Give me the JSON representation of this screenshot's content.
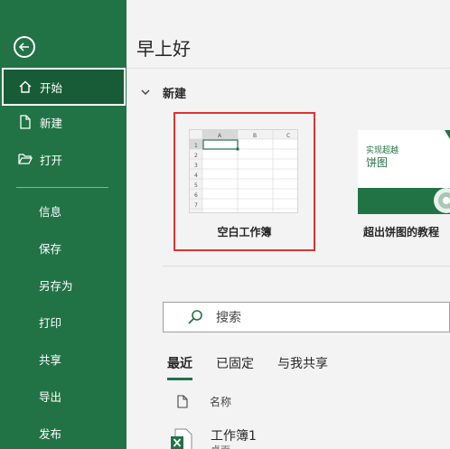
{
  "sidebar": {
    "items": [
      {
        "label": "开始",
        "icon": "home-icon",
        "active": true
      },
      {
        "label": "新建",
        "icon": "new-file-icon"
      },
      {
        "label": "打开",
        "icon": "open-folder-icon"
      },
      {
        "label": "信息"
      },
      {
        "label": "保存"
      },
      {
        "label": "另存为"
      },
      {
        "label": "打印"
      },
      {
        "label": "共享"
      },
      {
        "label": "导出"
      },
      {
        "label": "发布"
      }
    ]
  },
  "main": {
    "greeting": "早上好",
    "new_section": "新建",
    "templates": [
      {
        "label": "空白工作簿",
        "highlighted": true
      },
      {
        "label": "超出饼图的教程",
        "thumb_title_1": "实现超越",
        "thumb_title_2": "饼图"
      }
    ],
    "grid_columns": [
      "A",
      "B",
      "C"
    ],
    "grid_rows": [
      "1",
      "2",
      "3",
      "4",
      "5",
      "6",
      "7"
    ],
    "search_placeholder": "搜索",
    "tabs": [
      "最近",
      "已固定",
      "与我共享"
    ],
    "list_header": "名称",
    "recent_files": [
      {
        "name": "工作簿1",
        "location": "桌面"
      }
    ]
  },
  "colors": {
    "sidebar_bg": "#217346",
    "sidebar_active": "#185c37",
    "highlight": "#e03131",
    "accent": "#217346"
  }
}
